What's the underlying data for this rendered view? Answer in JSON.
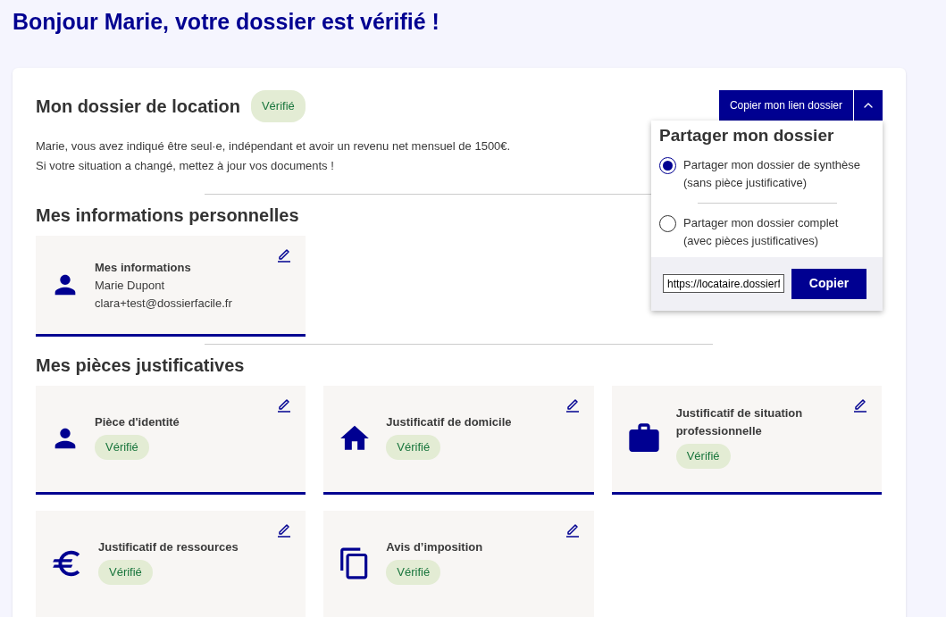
{
  "page_title": "Bonjour Marie, votre dossier est vérifié !",
  "dossier": {
    "title": "Mon dossier de location",
    "status": "Vérifié",
    "description": [
      "Marie, vous avez indiqué être seul·e, indépendant et avoir un revenu net mensuel de 1500€.",
      "Si votre situation a changé, mettez à jour vos documents !"
    ]
  },
  "share": {
    "button": "Copier mon lien dossier",
    "expanded": true,
    "menu": {
      "title": "Partager mon dossier",
      "options": [
        {
          "label": "Partager mon dossier de synthèse",
          "sublabel": "(sans pièce justificative)",
          "selected": true
        },
        {
          "label": "Partager mon dossier complet",
          "sublabel": "(avec pièces justificatives)",
          "selected": false
        }
      ],
      "link_value": "https://locataire.dossierf",
      "copy_button": "Copier"
    }
  },
  "personal": {
    "heading": "Mes informations personnelles",
    "card": {
      "title": "Mes informations",
      "name": "Marie Dupont",
      "email": "clara+test@dossierfacile.fr"
    }
  },
  "documents": {
    "heading": "Mes pièces justificatives",
    "items": [
      {
        "kind": "identity",
        "title": "Pièce d'identité",
        "status": "Vérifié"
      },
      {
        "kind": "residence",
        "title": "Justificatif de domicile",
        "status": "Vérifié"
      },
      {
        "kind": "professional",
        "title": "Justificatif de situation professionnelle",
        "status": "Vérifié"
      },
      {
        "kind": "financial",
        "title": "Justificatif de ressources",
        "status": "Vérifié"
      },
      {
        "kind": "tax",
        "title": "Avis d’imposition",
        "status": "Vérifié"
      }
    ]
  }
}
